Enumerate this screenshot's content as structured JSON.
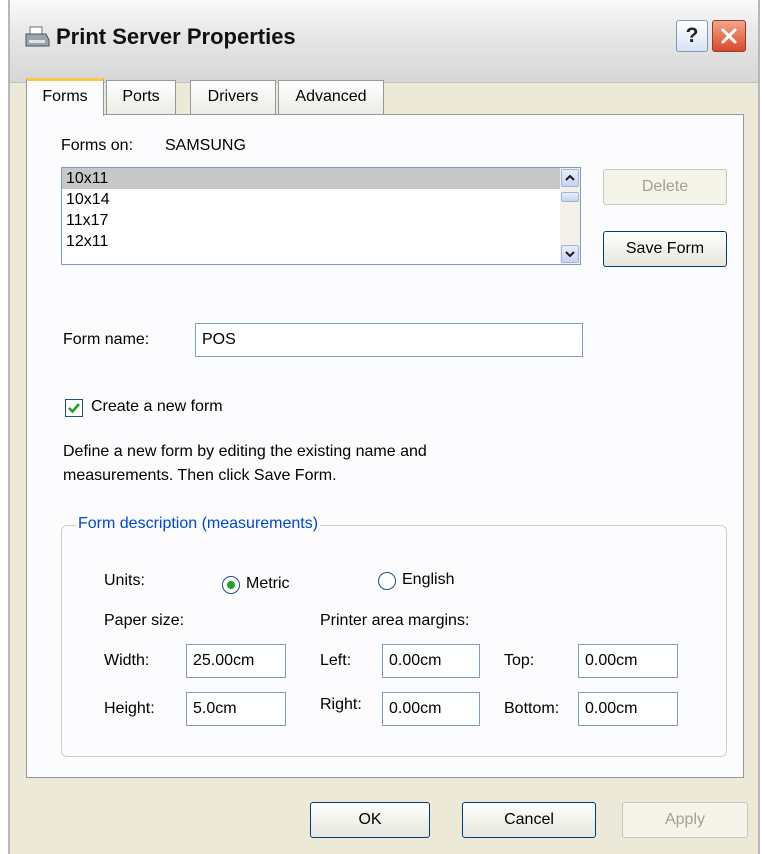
{
  "window": {
    "title": "Print Server Properties",
    "help_label": "?"
  },
  "tabs": [
    {
      "label": "Forms",
      "active": true
    },
    {
      "label": "Ports",
      "active": false
    },
    {
      "label": "Drivers",
      "active": false
    },
    {
      "label": "Advanced",
      "active": false
    }
  ],
  "forms": {
    "forms_on_label": "Forms on:",
    "server_name": "SAMSUNG",
    "list": [
      "10x11",
      "10x14",
      "11x17",
      "12x11"
    ],
    "selected": "10x11",
    "delete_label": "Delete",
    "save_form_label": "Save Form",
    "form_name_label": "Form name:",
    "form_name_value": "POS",
    "create_new_label": "Create a new form",
    "create_new_checked": true,
    "description_line1": "Define a new form by editing the existing name and",
    "description_line2": "measurements.  Then click Save Form."
  },
  "measurements": {
    "group_title": "Form description (measurements)",
    "units_label": "Units:",
    "metric_label": "Metric",
    "english_label": "English",
    "selected_unit": "Metric",
    "paper_size_label": "Paper size:",
    "margins_label": "Printer area margins:",
    "width_label": "Width:",
    "width_value": "25.00cm",
    "height_label": "Height:",
    "height_value": "5.0cm",
    "left_label": "Left:",
    "left_value": "0.00cm",
    "right_label": "Right:",
    "right_value": "0.00cm",
    "top_label": "Top:",
    "top_value": "0.00cm",
    "bottom_label": "Bottom:",
    "bottom_value": "0.00cm"
  },
  "footer": {
    "ok_label": "OK",
    "cancel_label": "Cancel",
    "apply_label": "Apply"
  },
  "colors": {
    "dialog_bg": "#ece9d8",
    "active_tab_accent": "#ffc83c",
    "group_title": "#0046d5",
    "close_button": "#d9492b",
    "radio_dot": "#21a121"
  }
}
